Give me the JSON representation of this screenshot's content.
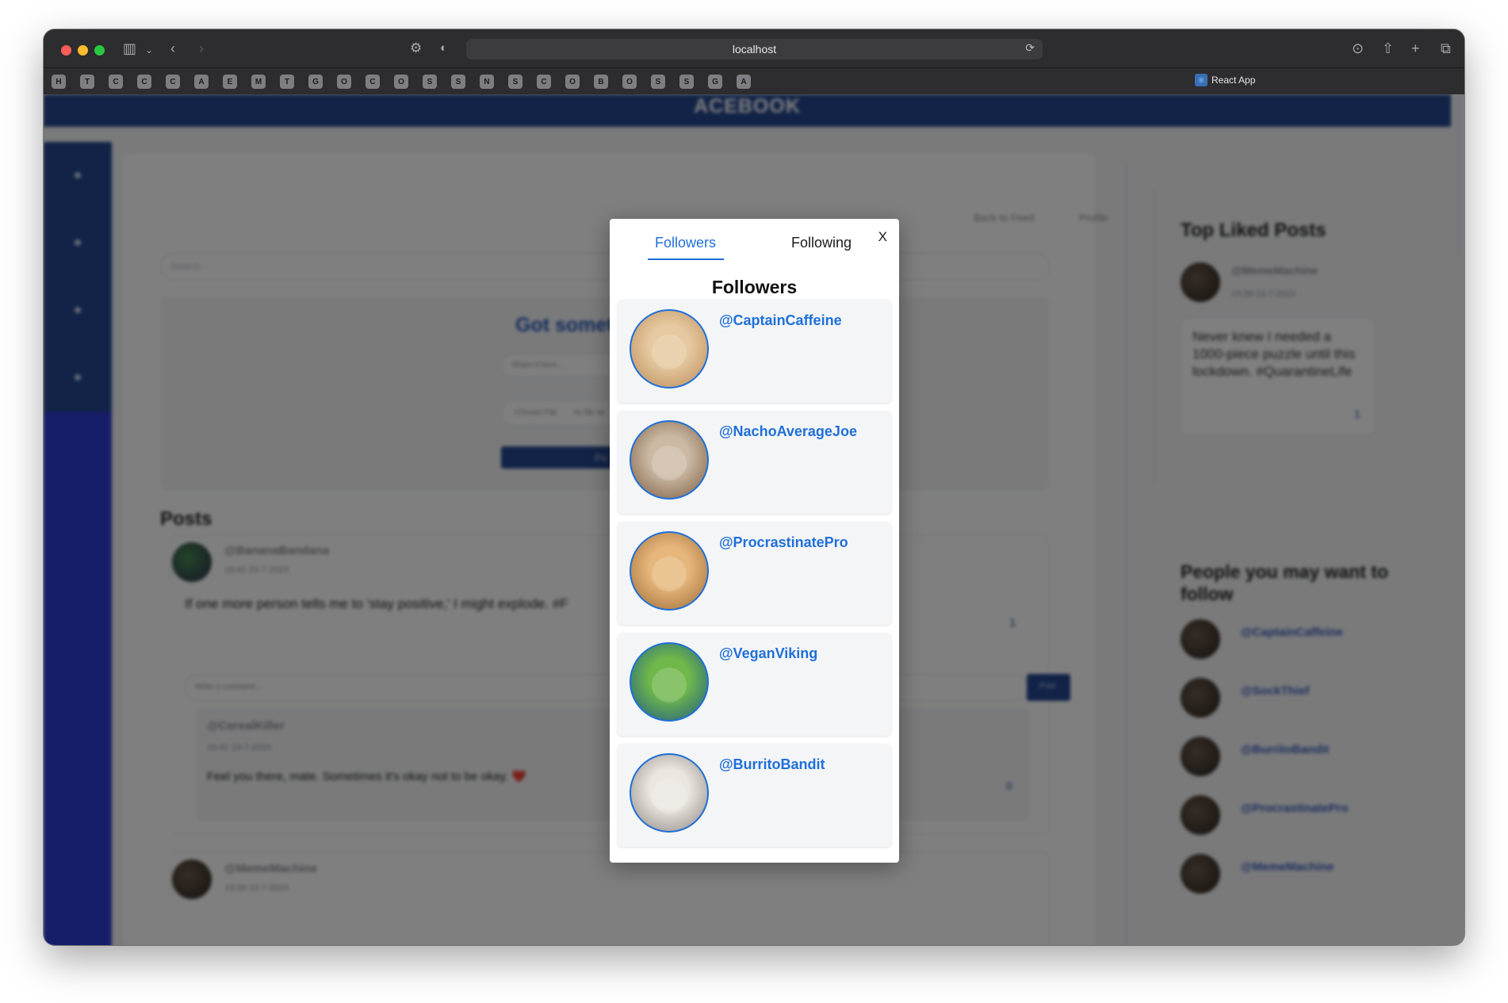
{
  "browser": {
    "url": "localhost",
    "active_tab_title": "React App",
    "favorites": [
      "H",
      "T",
      "C",
      "C",
      "C",
      "A",
      "E",
      "M",
      "T",
      "G",
      "O",
      "C",
      "O",
      "S",
      "S",
      "N",
      "S",
      "C",
      "O",
      "B",
      "O",
      "S",
      "S",
      "G",
      "A"
    ]
  },
  "app": {
    "brand": "ACEBOOK",
    "nav": {
      "back_to_feed": "Back to Feed",
      "profile": "Profile"
    },
    "search_placeholder": "Search",
    "compose": {
      "title": "Got somethi",
      "placeholder": "Share it here...",
      "file_button": "Choose File",
      "file_status": "no file se",
      "post_button": "Po"
    },
    "posts_heading": "Posts",
    "posts": [
      {
        "author": "@BananaBandana",
        "timestamp": "19:42 23-7-2023",
        "text": "If one more person tells me to 'stay positive,' I might explode. #F",
        "likes": "1",
        "comment_placeholder": "Write a comment...",
        "comment_button": "Post",
        "comment": {
          "author": "@CerealKiller",
          "timestamp": "19:42 23-7-2023",
          "text": "Feel you there, mate. Sometimes it's okay not to be okay. ❤️",
          "likes": "0"
        }
      },
      {
        "author": "@MemeMachine",
        "timestamp": "19:39 23-7-2023"
      }
    ],
    "top_liked": {
      "title": "Top Liked Posts",
      "author": "@MemeMachine",
      "timestamp": "19:39 23-7-2023",
      "text": "Never knew I needed a 1000-piece puzzle until this lockdown. #QuarantineLife",
      "likes": "1"
    },
    "people": {
      "title": "People you may want to follow",
      "names": [
        "@CaptainCaffeine",
        "@SockThief",
        "@BurritoBandit",
        "@ProcrastinatePro",
        "@MemeMachine"
      ]
    }
  },
  "modal": {
    "tabs": {
      "followers": "Followers",
      "following": "Following"
    },
    "close_label": "X",
    "title": "Followers",
    "followers": [
      {
        "handle": "@CaptainCaffeine",
        "avatar": "cat-with-sunglasses",
        "color_a": "#e6c9a0",
        "color_b": "#b98a59"
      },
      {
        "handle": "@NachoAverageJoe",
        "avatar": "caracal",
        "color_a": "#cbb9a4",
        "color_b": "#7a5a3d"
      },
      {
        "handle": "@ProcrastinatePro",
        "avatar": "shiba-inu",
        "color_a": "#e6b77c",
        "color_b": "#9c6a35"
      },
      {
        "handle": "@VeganViking",
        "avatar": "green-parrot",
        "color_a": "#6fb84a",
        "color_b": "#1e5a86"
      },
      {
        "handle": "@BurritoBandit",
        "avatar": "smiling-cat",
        "color_a": "#ebe6e0",
        "color_b": "#8b8580"
      }
    ]
  },
  "colors": {
    "accent": "#1f6fd8",
    "header": "#24478f",
    "sidebar_lower": "#2d3bd1"
  }
}
